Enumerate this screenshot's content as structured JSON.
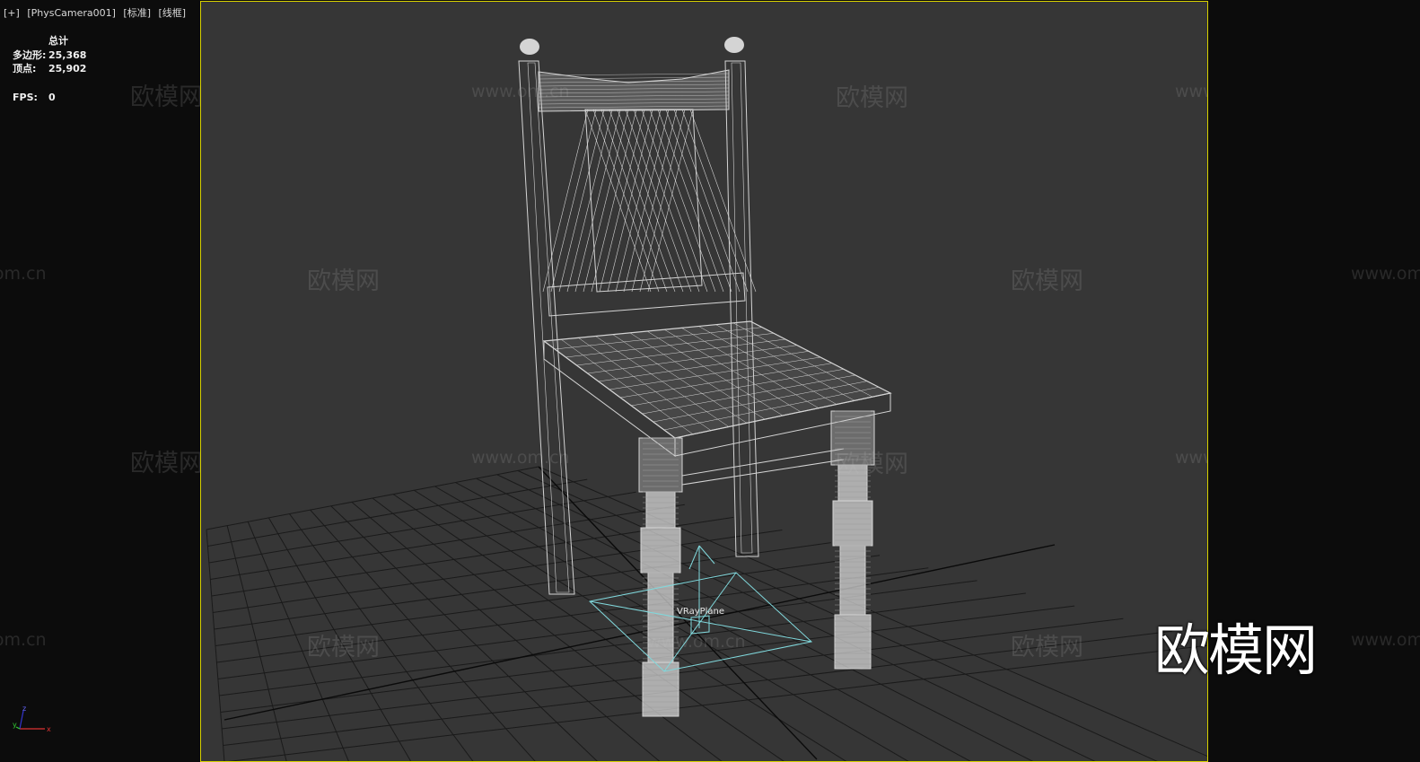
{
  "viewport": {
    "menu": "[+]",
    "camera": "[PhysCamera001]",
    "shading": "[标准]",
    "mode": "[线框]"
  },
  "stats": {
    "header": "总计",
    "polygons_label": "多边形:",
    "polygons_value": "25,368",
    "vertices_label": "顶点:",
    "vertices_value": "25,902",
    "fps_label": "FPS:",
    "fps_value": "0"
  },
  "scene": {
    "object_label": "VRayPlane",
    "axes": {
      "x": "x",
      "y": "y",
      "z": "z"
    }
  },
  "watermark": {
    "logo": "欧模网",
    "url": "www.om.cn"
  },
  "colors": {
    "viewport_border": "#d6d000",
    "viewport_bg": "#363636",
    "wireframe": "#d4d4d4",
    "helper": "#80d8dc"
  }
}
